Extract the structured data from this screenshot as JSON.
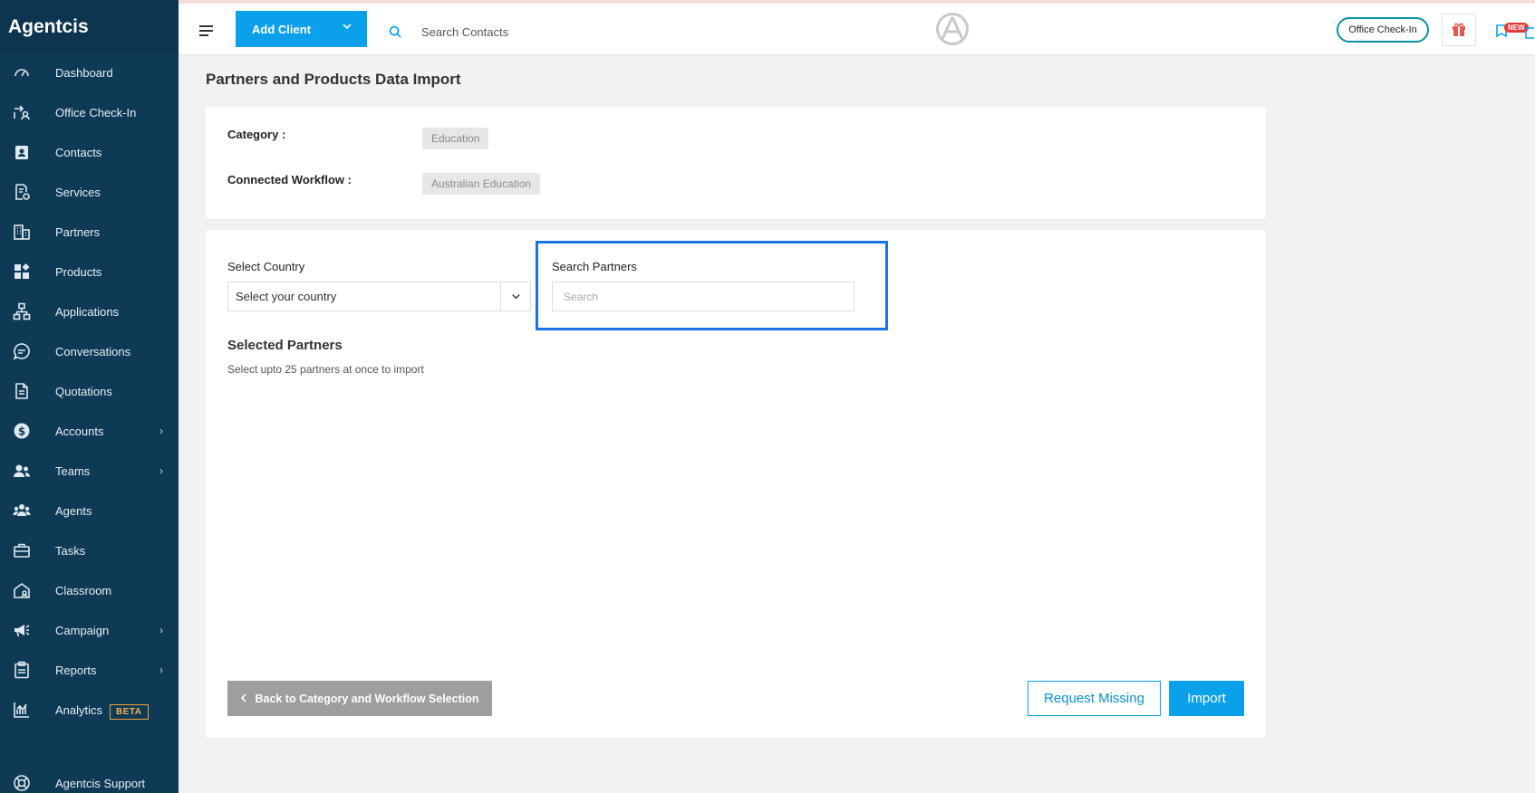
{
  "sidebar": {
    "brand": "Agentcis",
    "items": [
      {
        "label": "Dashboard",
        "icon": "gauge-icon"
      },
      {
        "label": "Office Check-In",
        "icon": "check-in-icon"
      },
      {
        "label": "Contacts",
        "icon": "contacts-icon"
      },
      {
        "label": "Services",
        "icon": "services-icon"
      },
      {
        "label": "Partners",
        "icon": "building-icon"
      },
      {
        "label": "Products",
        "icon": "products-icon"
      },
      {
        "label": "Applications",
        "icon": "flow-icon"
      },
      {
        "label": "Conversations",
        "icon": "chat-icon"
      },
      {
        "label": "Quotations",
        "icon": "document-icon"
      },
      {
        "label": "Accounts",
        "icon": "dollar-icon"
      },
      {
        "label": "Teams",
        "icon": "team-icon"
      },
      {
        "label": "Agents",
        "icon": "agents-icon"
      },
      {
        "label": "Tasks",
        "icon": "briefcase-icon"
      },
      {
        "label": "Classroom",
        "icon": "classroom-icon"
      },
      {
        "label": "Campaign",
        "icon": "megaphone-icon"
      },
      {
        "label": "Reports",
        "icon": "clipboard-icon"
      },
      {
        "label": "Analytics",
        "icon": "chart-icon",
        "badge": "BETA"
      },
      {
        "label": "Agentcis Support",
        "icon": "lifebuoy-icon"
      }
    ]
  },
  "topbar": {
    "add_client": "Add Client",
    "search_placeholder": "Search Contacts",
    "office_checkin": "Office Check-In",
    "new_badge": "NEW"
  },
  "page": {
    "title": "Partners and Products Data Import",
    "category_label": "Category :",
    "category_value": "Education",
    "workflow_label": "Connected Workflow :",
    "workflow_value": "Australian Education",
    "country_label": "Select Country",
    "country_value": "Select your country",
    "search_label": "Search Partners",
    "search_placeholder": "Search",
    "selected_title": "Selected Partners",
    "selected_hint": "Select upto 25 partners at once to import",
    "back_button": "Back to Category and Workflow Selection",
    "request_button": "Request Missing",
    "import_button": "Import"
  },
  "colors": {
    "sidebar": "#0f3a56",
    "primary": "#0aa0ea",
    "highlight": "#1a73e8"
  }
}
